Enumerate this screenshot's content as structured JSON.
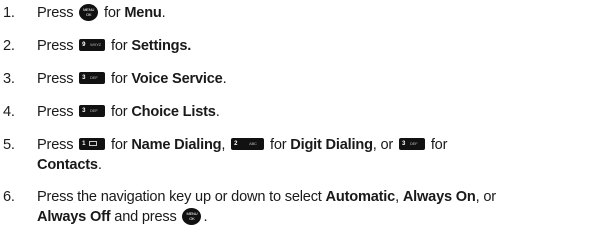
{
  "steps": [
    {
      "num": "1.",
      "t1": "Press",
      "key1": {
        "type": "menu-ok",
        "line1": "MENU",
        "line2": "OK"
      },
      "t2": "for",
      "b1": "Menu",
      "t3": "."
    },
    {
      "num": "2.",
      "t1": "Press",
      "key1": {
        "type": "9",
        "digit": "9",
        "letters": "WXYZ"
      },
      "t2": "for",
      "b1": "Settings."
    },
    {
      "num": "3.",
      "t1": "Press",
      "key1": {
        "type": "3",
        "digit": "3",
        "letters": "DEF"
      },
      "t2": "for",
      "b1": "Voice Service",
      "t3": "."
    },
    {
      "num": "4.",
      "t1": "Press",
      "key1": {
        "type": "3",
        "digit": "3",
        "letters": "DEF"
      },
      "t2": "for",
      "b1": "Choice Lists",
      "t3": "."
    },
    {
      "num": "5.",
      "t1": "Press",
      "key1": {
        "type": "1",
        "digit": "1",
        "letters": ""
      },
      "t2": "for",
      "b1": "Name Dialing",
      "t3": ",",
      "key2": {
        "type": "2",
        "digit": "2",
        "letters": "ABC"
      },
      "t4": "for",
      "b2": "Digit Dialing",
      "t5": ", or",
      "key3": {
        "type": "3",
        "digit": "3",
        "letters": "DEF"
      },
      "t6": "for",
      "b3": "Contacts",
      "t7": "."
    },
    {
      "num": "6.",
      "t1": "Press the navigation key up or down to select",
      "b1": "Automatic",
      "t2": ",",
      "b2": "Always On",
      "t3": ", or",
      "b3": "Always Off",
      "t4": "and press",
      "key1": {
        "type": "menu-ok",
        "line1": "MENU",
        "line2": "OK"
      },
      "t5": "."
    }
  ]
}
